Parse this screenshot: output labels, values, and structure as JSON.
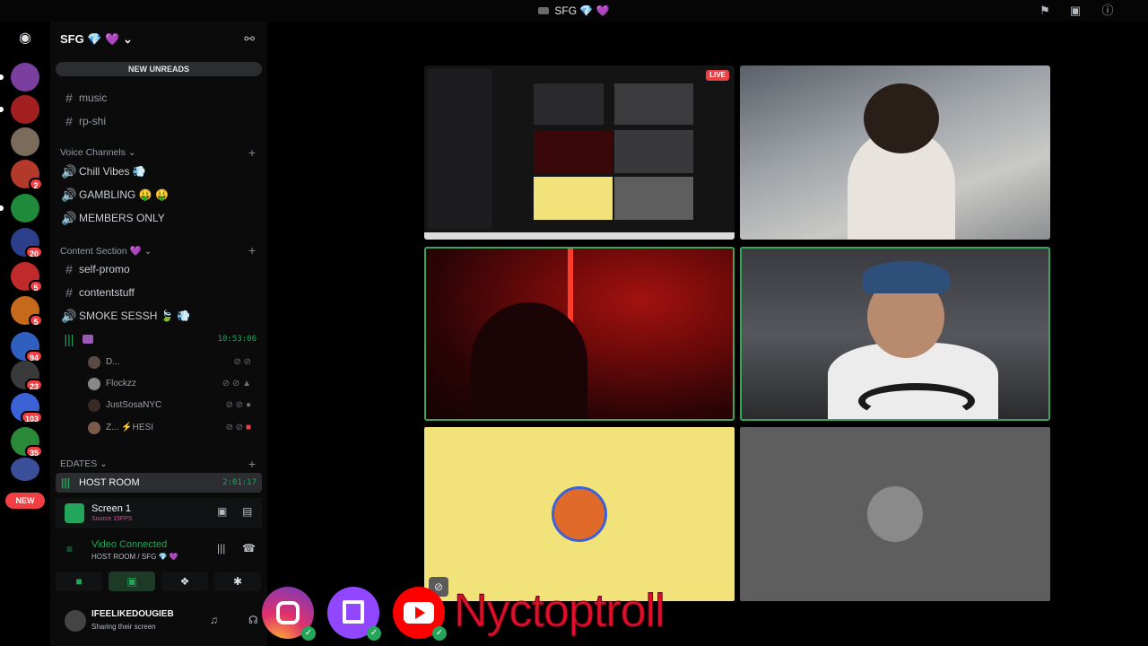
{
  "window": {
    "title": "SFG 💎 💜"
  },
  "server": {
    "name": "SFG 💎 💜",
    "new_unreads": "NEW UNREADS",
    "rail_badges": [
      "2",
      "20",
      "5",
      "5",
      "94",
      "23",
      "103",
      "35"
    ],
    "rail_new": "NEW"
  },
  "channels": {
    "text_top": [
      "music",
      "rp-shi"
    ],
    "voice_category": "Voice Channels",
    "voice": [
      "Chill Vibes 💨",
      "GAMBLING 🤑 🤑",
      "MEMBERS ONLY"
    ],
    "content_category": "Content Section 💜",
    "content_text": [
      "self-promo",
      "contentstuff"
    ],
    "smoke": "SMOKE SESSH 🍃 💨",
    "live_timer": "10:53:06",
    "voice_users": [
      "D...",
      "Flockzz",
      "JustSosaNYC",
      "Z... ⚡HESI"
    ],
    "edates_category": "EDATES",
    "host_room": "HOST ROOM",
    "host_timer": "2:01:17"
  },
  "stream_panel": {
    "name": "Screen 1",
    "sub": "Source 15FPS"
  },
  "voice_panel": {
    "status": "Video Connected",
    "route": "HOST ROOM / SFG 💎 💜"
  },
  "user": {
    "name": "IFEELIKEDOUGIEB",
    "status": "Sharing their screen"
  },
  "stage": {
    "live_badge": "LIVE"
  },
  "overlay": {
    "handle": "Nyctoptroll",
    "platforms": [
      "instagram-icon",
      "twitch-icon",
      "youtube-icon"
    ]
  },
  "colors": {
    "accent_green": "#23a55a",
    "live_red": "#ed4245",
    "handle_red": "#e0102a"
  }
}
